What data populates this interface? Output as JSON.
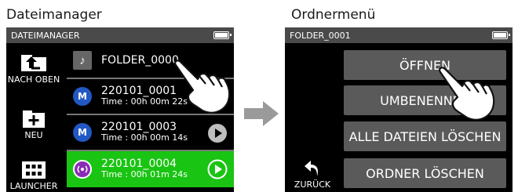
{
  "captions": {
    "left": "Dateimanager",
    "right": "Ordnermenü"
  },
  "left_screen": {
    "status_title": "DATEIMANAGER",
    "side_buttons": {
      "up": "NACH OBEN",
      "new": "NEU",
      "launcher": "LAUNCHER"
    },
    "files": [
      {
        "type": "folder",
        "icon": "music-folder-icon",
        "name": "FOLDER_0000",
        "time": ""
      },
      {
        "type": "mono",
        "icon": "mono-file-icon",
        "name": "220101_0001",
        "time": "Time : 00h 00m 22s"
      },
      {
        "type": "mono",
        "icon": "mono-file-icon",
        "name": "220101_0003",
        "time": "Time : 00h 00m 14s"
      },
      {
        "type": "poly",
        "icon": "poly-file-icon",
        "name": "220101_0004",
        "time": "Time : 00h 01m 24s"
      }
    ],
    "mono_badge": "M",
    "selected_color": "#19c412"
  },
  "right_screen": {
    "status_title": "FOLDER_0001",
    "menu": {
      "open": "ÖFFNEN",
      "rename": "UMBENENNEN",
      "delete_all": "ALLE DATEIEN LÖSCHEN",
      "delete_folder": "ORDNER LÖSCHEN"
    },
    "back": "ZURÜCK"
  },
  "colors": {
    "status_bar": "#4a4a4a",
    "menu_button": "#5a5a5a",
    "mono_icon": "#2158c4",
    "poly_icon": "#8a2bb5",
    "arrow": "#9a9a9a"
  }
}
